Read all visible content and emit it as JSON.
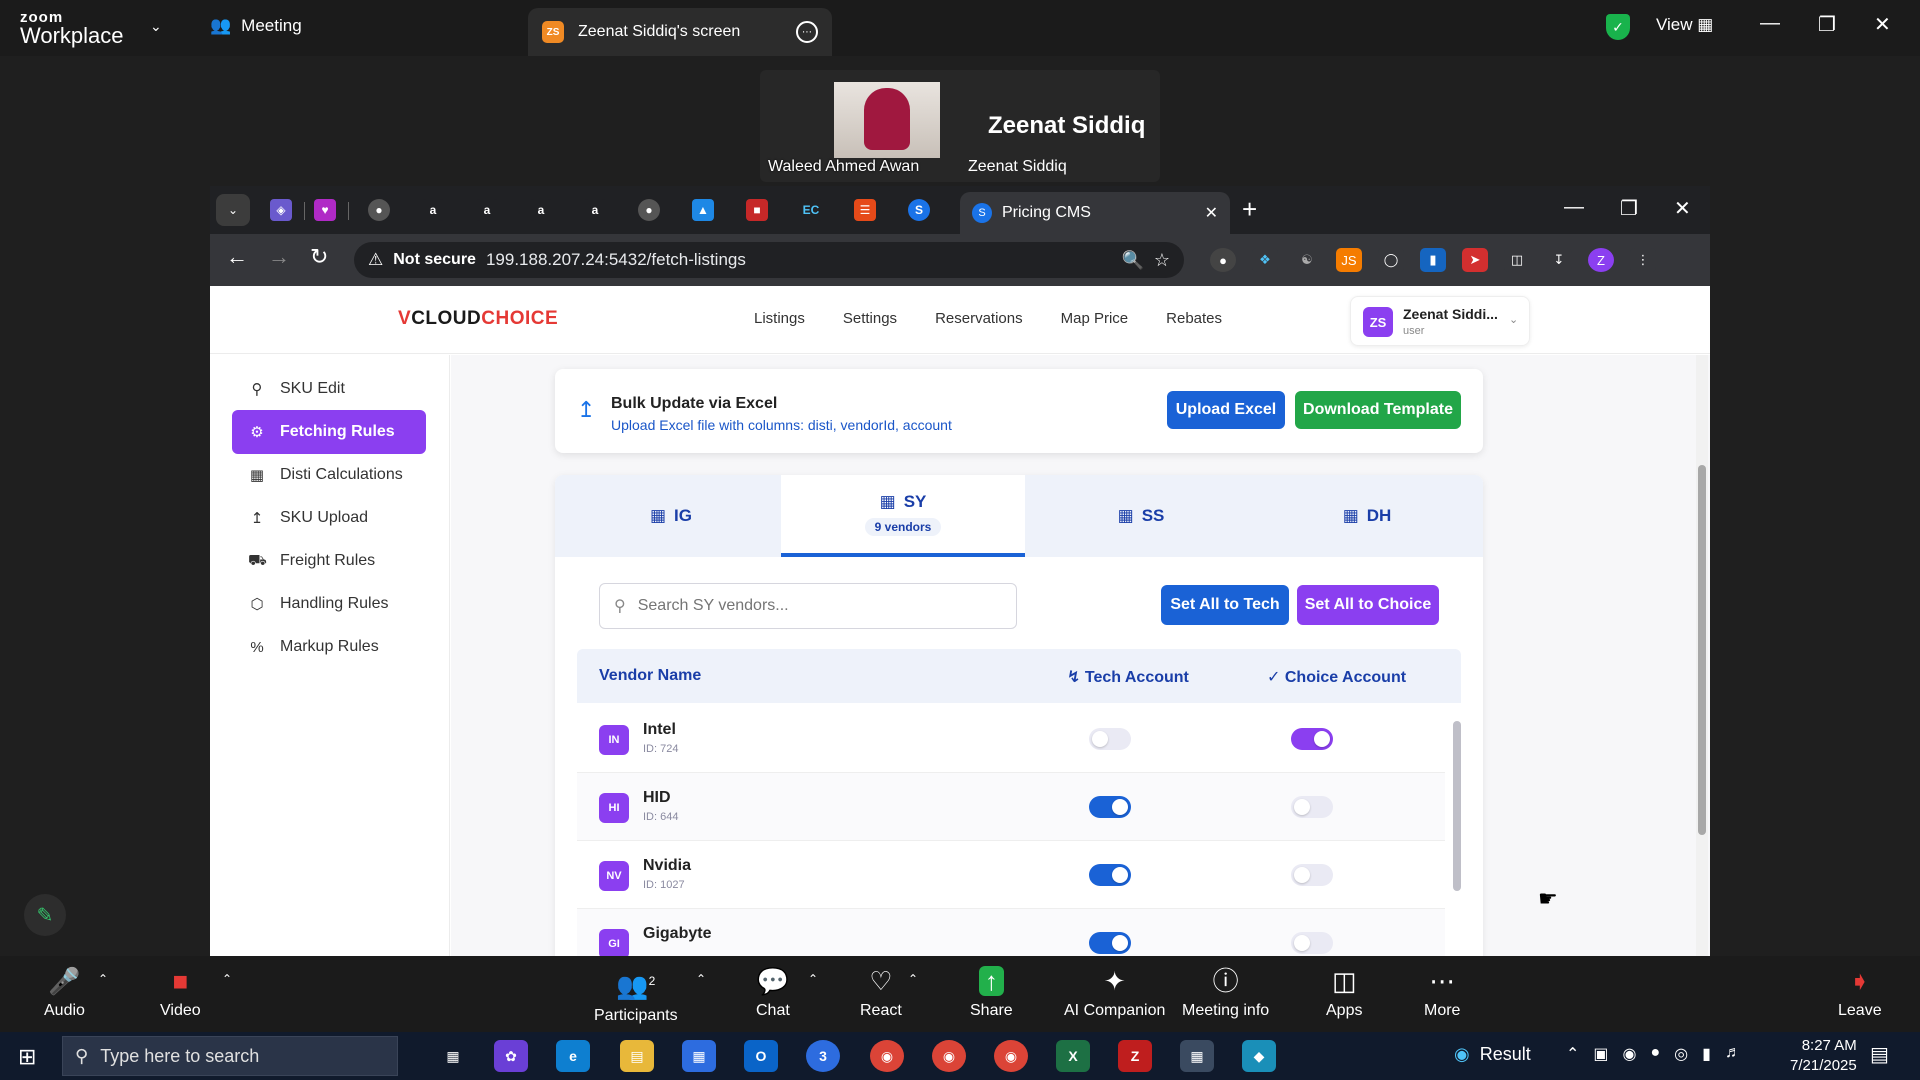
{
  "zoom": {
    "brand_top": "zoom",
    "brand_bottom": "Workplace",
    "meeting_label": "Meeting",
    "share_tab_badge": "ZS",
    "share_tab_label": "Zeenat Siddiq's screen",
    "view_label": "View",
    "video": {
      "participant_1": "Waleed Ahmed Awan",
      "big_name": "Zeenat Siddiq",
      "participant_2": "Zeenat Siddiq"
    },
    "bottom": [
      {
        "label": "Audio",
        "icon": "microphone-icon"
      },
      {
        "label": "Video",
        "icon": "video-off-icon"
      },
      {
        "label": "Participants",
        "icon": "participants-icon",
        "count": "2"
      },
      {
        "label": "Chat",
        "icon": "chat-icon"
      },
      {
        "label": "React",
        "icon": "heart-icon"
      },
      {
        "label": "Share",
        "icon": "share-icon"
      },
      {
        "label": "AI Companion",
        "icon": "ai-sparkle-icon"
      },
      {
        "label": "Meeting info",
        "icon": "info-icon"
      },
      {
        "label": "Apps",
        "icon": "apps-icon"
      },
      {
        "label": "More",
        "icon": "more-icon"
      },
      {
        "label": "Leave",
        "icon": "leave-icon"
      }
    ]
  },
  "browser": {
    "active_tab_title": "Pricing CMS",
    "not_secure": "Not secure",
    "url": "199.188.207.24:5432/fetch-listings",
    "profile_initial": "Z"
  },
  "app": {
    "logo_v": "V",
    "logo_cloud": "CLOUD",
    "logo_choice": "CHOICE",
    "nav": [
      "Listings",
      "Settings",
      "Reservations",
      "Map Price",
      "Rebates"
    ],
    "user": {
      "initials": "ZS",
      "name": "Zeenat Siddi...",
      "role": "user"
    },
    "sidebar": [
      {
        "label": "SKU Edit",
        "icon": "search-icon",
        "active": false
      },
      {
        "label": "Fetching Rules",
        "icon": "gear-icon",
        "active": true
      },
      {
        "label": "Disti Calculations",
        "icon": "calculator-icon",
        "active": false
      },
      {
        "label": "SKU Upload",
        "icon": "upload-icon",
        "active": false
      },
      {
        "label": "Freight Rules",
        "icon": "truck-icon",
        "active": false
      },
      {
        "label": "Handling Rules",
        "icon": "box-icon",
        "active": false
      },
      {
        "label": "Markup Rules",
        "icon": "percent-icon",
        "active": false
      }
    ],
    "bulk": {
      "title": "Bulk Update via Excel",
      "subtitle": "Upload Excel file with columns: disti, vendorId, account",
      "upload_label": "Upload Excel",
      "download_label": "Download Template"
    },
    "dist_tabs": [
      {
        "label": "IG",
        "badge": ""
      },
      {
        "label": "SY",
        "badge": "9 vendors"
      },
      {
        "label": "SS",
        "badge": ""
      },
      {
        "label": "DH",
        "badge": ""
      }
    ],
    "search_placeholder": "Search SY vendors...",
    "set_tech_label": "Set All to Tech",
    "set_choice_label": "Set All to Choice",
    "table": {
      "col_vendor": "Vendor Name",
      "col_tech": "Tech Account",
      "col_choice": "Choice Account",
      "rows": [
        {
          "initials": "IN",
          "name": "Intel",
          "id": "ID: 724",
          "tech": false,
          "choice": true
        },
        {
          "initials": "HI",
          "name": "HID",
          "id": "ID: 644",
          "tech": true,
          "choice": false
        },
        {
          "initials": "NV",
          "name": "Nvidia",
          "id": "ID: 1027",
          "tech": true,
          "choice": false
        },
        {
          "initials": "GI",
          "name": "Gigabyte",
          "id": "",
          "tech": true,
          "choice": false
        }
      ]
    }
  },
  "taskbar": {
    "search_placeholder": "Type here to search",
    "result_label": "Result",
    "time": "8:27 AM",
    "date": "7/21/2025",
    "outlook_badge": "3"
  },
  "colors": {
    "accent_purple": "#8b3ff0",
    "accent_blue": "#1a62d6",
    "accent_green": "#22a648"
  }
}
